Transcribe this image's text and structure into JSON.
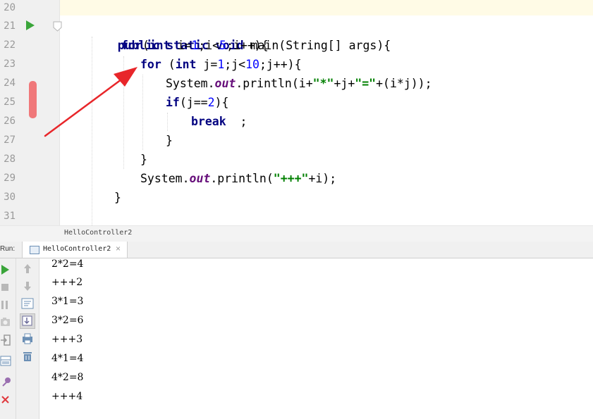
{
  "editor": {
    "line_numbers": [
      "20",
      "21",
      "22",
      "23",
      "24",
      "25",
      "26",
      "27",
      "28",
      "29",
      "30",
      "31"
    ],
    "code": {
      "l21": [
        "public",
        "static",
        "void",
        "main(String[] args){"
      ],
      "l22": [
        "for",
        "(",
        "int",
        " i=",
        "1",
        ";i<",
        "5",
        ";i++){"
      ],
      "l23": [
        "for",
        " (",
        "int",
        " j=",
        "1",
        ";j<",
        "10",
        ";j++){"
      ],
      "l24": [
        "System.",
        "out",
        ".println(i+",
        "\"*\"",
        "+j+",
        "\"=\"",
        "+(i*j));"
      ],
      "l25": [
        "if",
        "(j==",
        "2",
        "){"
      ],
      "l26": [
        "break",
        "  ;"
      ],
      "l27": [
        "}"
      ],
      "l28": [
        "}"
      ],
      "l29": [
        "System.",
        "out",
        ".println(",
        "\"+++\"",
        "+i);"
      ],
      "l30": [
        "}"
      ]
    }
  },
  "breadcrumb": {
    "text": "HelloController2"
  },
  "run": {
    "label": "Run:",
    "tab_label": "HelloController2",
    "close_glyph": "×",
    "output": [
      "2*2=4",
      "+++2",
      "3*1=3",
      "3*2=6",
      "+++3",
      "4*1=4",
      "4*2=8",
      "+++4"
    ]
  },
  "colors": {
    "keyword": "#000080",
    "number": "#0000ff",
    "string": "#008000",
    "field": "#660e7a",
    "annotation_arrow": "#e8262a",
    "breakpoint_mark": "#f0787a"
  },
  "icons": {
    "gutter": [
      "run-gutter-icon",
      "fold-icon"
    ],
    "toolbar_left": [
      "rerun-icon",
      "stop-icon",
      "pause-icon",
      "dump-threads-icon",
      "exit-icon",
      "layout-icon",
      "pin-icon",
      "close-icon"
    ],
    "toolbar_right": [
      "scroll-up-icon",
      "scroll-down-icon",
      "soft-wrap-icon",
      "scroll-to-end-icon",
      "print-icon",
      "trash-icon"
    ]
  }
}
